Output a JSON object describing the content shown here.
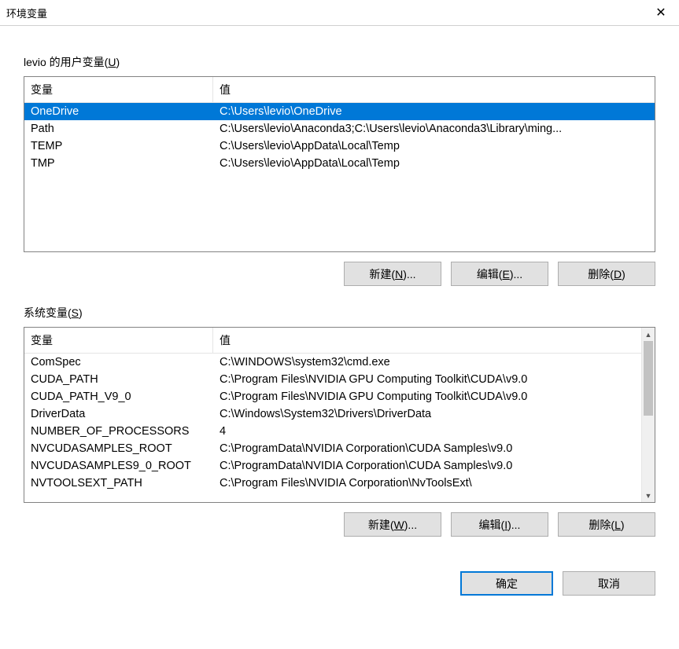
{
  "window": {
    "title": "环境变量"
  },
  "user_section": {
    "label_prefix": "levio 的用户变量(",
    "label_key": "U",
    "label_suffix": ")",
    "header_var": "变量",
    "header_val": "值",
    "rows": [
      {
        "name": "OneDrive",
        "value": "C:\\Users\\levio\\OneDrive",
        "selected": true
      },
      {
        "name": "Path",
        "value": "C:\\Users\\levio\\Anaconda3;C:\\Users\\levio\\Anaconda3\\Library\\ming...",
        "selected": false
      },
      {
        "name": "TEMP",
        "value": "C:\\Users\\levio\\AppData\\Local\\Temp",
        "selected": false
      },
      {
        "name": "TMP",
        "value": "C:\\Users\\levio\\AppData\\Local\\Temp",
        "selected": false
      }
    ],
    "buttons": {
      "new_prefix": "新建(",
      "new_key": "N",
      "new_suffix": ")...",
      "edit_prefix": "编辑(",
      "edit_key": "E",
      "edit_suffix": ")...",
      "delete_prefix": "删除(",
      "delete_key": "D",
      "delete_suffix": ")"
    }
  },
  "system_section": {
    "label_prefix": "系统变量(",
    "label_key": "S",
    "label_suffix": ")",
    "header_var": "变量",
    "header_val": "值",
    "rows": [
      {
        "name": "ComSpec",
        "value": "C:\\WINDOWS\\system32\\cmd.exe"
      },
      {
        "name": "CUDA_PATH",
        "value": "C:\\Program Files\\NVIDIA GPU Computing Toolkit\\CUDA\\v9.0"
      },
      {
        "name": "CUDA_PATH_V9_0",
        "value": "C:\\Program Files\\NVIDIA GPU Computing Toolkit\\CUDA\\v9.0"
      },
      {
        "name": "DriverData",
        "value": "C:\\Windows\\System32\\Drivers\\DriverData"
      },
      {
        "name": "NUMBER_OF_PROCESSORS",
        "value": "4"
      },
      {
        "name": "NVCUDASAMPLES_ROOT",
        "value": "C:\\ProgramData\\NVIDIA Corporation\\CUDA Samples\\v9.0"
      },
      {
        "name": "NVCUDASAMPLES9_0_ROOT",
        "value": "C:\\ProgramData\\NVIDIA Corporation\\CUDA Samples\\v9.0"
      },
      {
        "name": "NVTOOLSEXT_PATH",
        "value": "C:\\Program Files\\NVIDIA Corporation\\NvToolsExt\\"
      }
    ],
    "buttons": {
      "new_prefix": "新建(",
      "new_key": "W",
      "new_suffix": ")...",
      "edit_prefix": "编辑(",
      "edit_key": "I",
      "edit_suffix": ")...",
      "delete_prefix": "删除(",
      "delete_key": "L",
      "delete_suffix": ")"
    }
  },
  "dialog_buttons": {
    "ok": "确定",
    "cancel": "取消"
  }
}
